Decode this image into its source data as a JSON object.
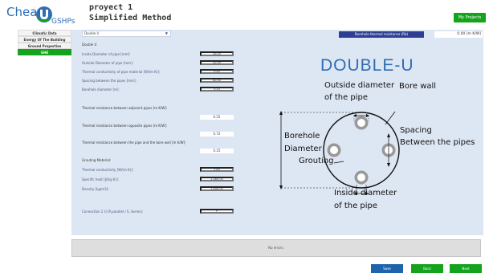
{
  "logo": {
    "cheap": "Cheap",
    "gshps": "GSHPs"
  },
  "project": {
    "name": "proyect 1",
    "method": "Simplified Method"
  },
  "header": {
    "my_projects": "My Projects"
  },
  "sidebar": {
    "items": [
      {
        "label": "Climatic Data"
      },
      {
        "label": "Energy Of The Building"
      },
      {
        "label": "Ground Properties"
      },
      {
        "label": "GHE"
      }
    ]
  },
  "main": {
    "config_select": "Double U",
    "borehole_resistance_label": "Borehole thermal resistance (Rb)",
    "borehole_resistance_value": "0.00  [m K/W]",
    "section_pipe": "Double U",
    "fields": [
      {
        "label": "Inside Diameter of pipe [mm]:",
        "value": "26.00"
      },
      {
        "label": "Outside Diameter of pipe [mm]:",
        "value": "32.00"
      },
      {
        "label": "Thermal conductivity of pipe material  [W/(m K)]:",
        "value": "0.40"
      },
      {
        "label": "Spacing between the pipes [mm]:",
        "value": "82.00"
      },
      {
        "label": "Borehole diameter [m]:",
        "value": "0.14"
      }
    ],
    "resistances": [
      {
        "label": "Thermal resistance between adjacent pipes [m K/W]:",
        "value": "0.55"
      },
      {
        "label": "Thermal resistance between opposite pipes [m K/W]:",
        "value": "0.72"
      },
      {
        "label": "Thermal resistance between the pipe and the bore wall [m K/W]:",
        "value": "0.25"
      }
    ],
    "section_grout": "Grouting Material:",
    "grout_fields": [
      {
        "label": "Thermal conductivity [W/(m K)]:",
        "value": "1.83"
      },
      {
        "label": "Specific heat [J/(kg K)]:",
        "value": "1,460.00"
      },
      {
        "label": "Density [kg/m3]:",
        "value": "1,655.00"
      }
    ],
    "connection": {
      "label": "Connection 2 U (P,parallel / S, Series):",
      "value": "P"
    }
  },
  "diagram": {
    "title": "DOUBLE-U",
    "outside_diameter": "Outside diameter",
    "of_the_pipe_1": "of the pipe",
    "bore_wall": "Bore wall",
    "borehole": "Borehole",
    "diameter": "Diameter",
    "spacing": "Spacing",
    "between_pipes": "Between the pipes",
    "grouting": "Grouting",
    "inside_diameter": "Inside diameter",
    "of_the_pipe_2": "of the pipe"
  },
  "errors": {
    "text": "No errors."
  },
  "footer": {
    "save": "Save",
    "back": "Back",
    "next": "Next"
  },
  "colors": {
    "accent_green": "#14a31c",
    "accent_blue": "#2e3f93",
    "panel_bg": "#dde6f3",
    "logo_blue": "#2f6db5"
  }
}
